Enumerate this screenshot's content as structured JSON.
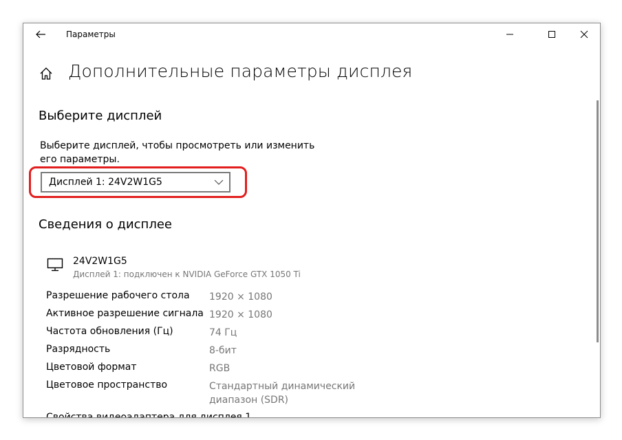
{
  "app": {
    "title": "Параметры"
  },
  "page": {
    "title": "Дополнительные параметры дисплея"
  },
  "select_display": {
    "section_title": "Выберите дисплей",
    "description": "Выберите дисплей, чтобы просмотреть или изменить его параметры.",
    "dropdown_value": "Дисплей 1: 24V2W1G5"
  },
  "display_info": {
    "section_title": "Сведения о дисплее",
    "name": "24V2W1G5",
    "subtitle": "Дисплей 1: подключен к NVIDIA GeForce GTX 1050 Ti",
    "properties": [
      {
        "label": "Разрешение рабочего стола",
        "value": "1920 × 1080"
      },
      {
        "label": "Активное разрешение сигнала",
        "value": "1920 × 1080"
      },
      {
        "label": "Частота обновления (Гц)",
        "value": "74 Гц"
      },
      {
        "label": "Разрядность",
        "value": "8-бит"
      },
      {
        "label": "Цветовой формат",
        "value": "RGB"
      },
      {
        "label": "Цветовое пространство",
        "value": "Стандартный динамический диапазон (SDR)"
      }
    ],
    "adapter_link": "Свойства видеоадаптера для дисплея 1"
  },
  "icons": {
    "back": "back-arrow-icon",
    "home": "home-icon",
    "monitor": "monitor-icon",
    "chevron": "chevron-down-icon",
    "minimize": "minimize-icon",
    "maximize": "maximize-icon",
    "close": "close-icon"
  },
  "colors": {
    "highlight": "#e21d1d",
    "secondary_text": "#767676"
  }
}
